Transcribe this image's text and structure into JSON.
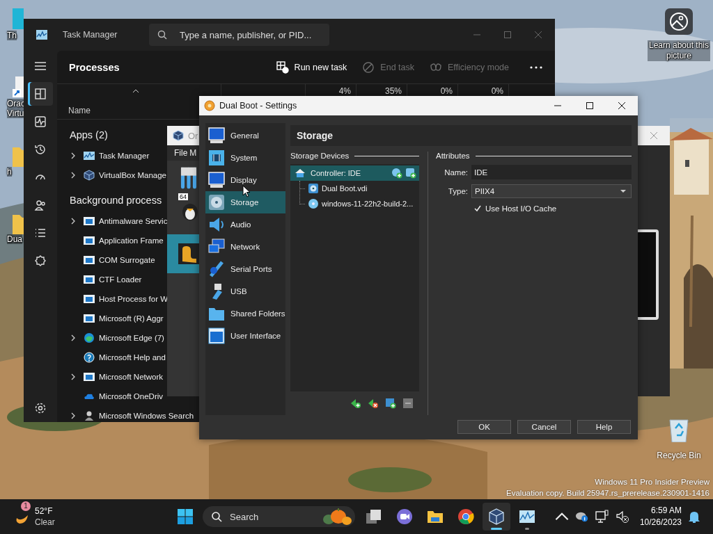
{
  "desktop": {
    "icons": [
      {
        "kind": "monitor",
        "label_lines": [
          "Th"
        ]
      },
      {
        "kind": "shortcut",
        "label_lines": [
          "Orac",
          "Virtu"
        ]
      },
      {
        "kind": "folder",
        "label_lines": [
          "h"
        ]
      },
      {
        "kind": "folder",
        "label_lines": [
          "Dua"
        ]
      }
    ],
    "spotlight": {
      "label": "Learn about this picture"
    },
    "recycle_bin": {
      "label": "Recycle Bin"
    },
    "watermark": [
      "Windows 11 Pro Insider Preview",
      "Evaluation copy. Build 25947.rs_prerelease.230901-1416"
    ]
  },
  "task_manager": {
    "title": "Task Manager",
    "search": {
      "placeholder": "Type a name, publisher, or PID..."
    },
    "nav": [
      {
        "kind": "processes",
        "selected": true
      },
      {
        "kind": "performance",
        "selected": false
      },
      {
        "kind": "history",
        "selected": false
      },
      {
        "kind": "startup",
        "selected": false
      },
      {
        "kind": "users",
        "selected": false
      },
      {
        "kind": "details",
        "selected": false
      },
      {
        "kind": "services",
        "selected": false
      },
      {
        "kind": "settings",
        "selected": false
      }
    ],
    "page_title": "Processes",
    "actions": [
      {
        "kind": "run",
        "label": "Run new task",
        "disabled": false
      },
      {
        "kind": "end",
        "label": "End task",
        "disabled": true
      },
      {
        "kind": "efficiency",
        "label": "Efficiency mode",
        "disabled": true
      }
    ],
    "name_column": "Name",
    "usage": [
      "4%",
      "35%",
      "0%",
      "0%"
    ],
    "groups": [
      {
        "title": "Apps (2)",
        "rows": [
          {
            "name": "Task Manager",
            "kind": "taskmgr",
            "expandable": true
          },
          {
            "name": "VirtualBox Manage",
            "kind": "vbox",
            "expandable": true
          }
        ]
      },
      {
        "title": "Background process",
        "rows": [
          {
            "name": "Antimalware Servic",
            "kind": "app",
            "expandable": true
          },
          {
            "name": "Application Frame",
            "kind": "app",
            "expandable": false
          },
          {
            "name": "COM Surrogate",
            "kind": "app",
            "expandable": false
          },
          {
            "name": "CTF Loader",
            "kind": "app",
            "expandable": false
          },
          {
            "name": "Host Process for W",
            "kind": "app",
            "expandable": false
          },
          {
            "name": "Microsoft (R) Aggr",
            "kind": "app",
            "expandable": false
          },
          {
            "name": "Microsoft Edge (7)",
            "kind": "edge",
            "expandable": true
          },
          {
            "name": "Microsoft Help and",
            "kind": "help",
            "expandable": false
          },
          {
            "name": "Microsoft Network",
            "kind": "app",
            "expandable": true
          },
          {
            "name": "Microsoft OneDriv",
            "kind": "onedrive",
            "expandable": false
          },
          {
            "name": "Microsoft Windows Search",
            "kind": "search",
            "expandable": true
          }
        ]
      }
    ]
  },
  "virtualbox": {
    "title": "Or",
    "menu": [
      "File",
      "M"
    ],
    "machines": [
      {
        "kind": "linux",
        "os_badge": "64",
        "selected": false
      },
      {
        "kind": "other",
        "selected": true
      }
    ]
  },
  "settings": {
    "title": "Dual Boot - Settings",
    "sections": [
      {
        "label": "General",
        "kind": "monitor",
        "selected": false
      },
      {
        "label": "System",
        "kind": "chip",
        "selected": false
      },
      {
        "label": "Display",
        "kind": "monitor",
        "selected": false
      },
      {
        "label": "Storage",
        "kind": "disk",
        "selected": true
      },
      {
        "label": "Audio",
        "kind": "speaker",
        "selected": false
      },
      {
        "label": "Network",
        "kind": "network",
        "selected": false
      },
      {
        "label": "Serial Ports",
        "kind": "serial",
        "selected": false
      },
      {
        "label": "USB",
        "kind": "usb",
        "selected": false
      },
      {
        "label": "Shared Folders",
        "kind": "folder",
        "selected": false
      },
      {
        "label": "User Interface",
        "kind": "window",
        "selected": false
      }
    ],
    "page_title": "Storage",
    "devices_label": "Storage Devices",
    "tree": [
      {
        "label": "Controller: IDE",
        "kind": "controller",
        "selected": true,
        "children": [
          {
            "label": "Dual Boot.vdi",
            "kind": "disk",
            "selected": false
          },
          {
            "label": "windows-11-22h2-build-2...",
            "kind": "optical",
            "selected": false
          }
        ]
      }
    ],
    "attributes_label": "Attributes",
    "name_field": {
      "label": "Name:",
      "value": "IDE"
    },
    "type_field": {
      "label": "Type:",
      "value": "PIIX4"
    },
    "host_io_cache": {
      "label": "Use Host I/O Cache",
      "checked": true
    },
    "buttons": [
      "OK",
      "Cancel",
      "Help"
    ]
  },
  "taskbar": {
    "weather": {
      "temp": "52°F",
      "condition": "Clear",
      "badge": "1"
    },
    "search": {
      "placeholder": "Search"
    },
    "apps": [
      {
        "kind": "taskview",
        "running": false,
        "active": false
      },
      {
        "kind": "chat",
        "running": false,
        "active": false
      },
      {
        "kind": "explorer",
        "running": false,
        "active": false
      },
      {
        "kind": "chrome",
        "running": false,
        "active": false
      },
      {
        "kind": "virtualbox",
        "running": true,
        "active": true
      },
      {
        "kind": "taskmanager",
        "running": true,
        "active": false
      }
    ],
    "time": "6:59 AM",
    "date": "10/26/2023"
  }
}
